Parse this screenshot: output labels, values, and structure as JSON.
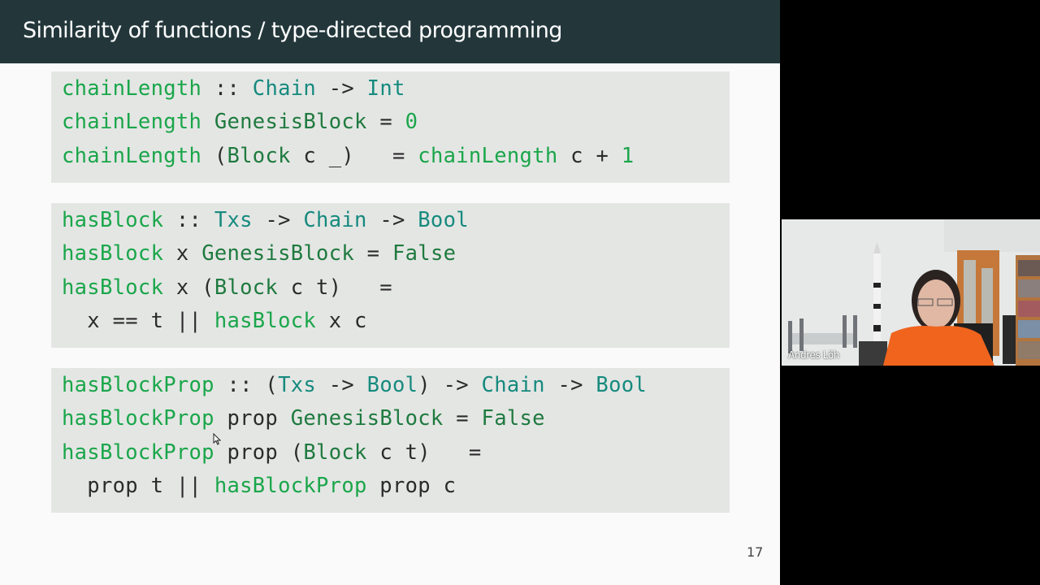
{
  "slide": {
    "title": "Similarity of functions / type-directed programming",
    "page_number": "17",
    "code_blocks": [
      {
        "lines": [
          [
            {
              "t": "chainLength",
              "k": "fn"
            },
            {
              "t": " :: ",
              "k": "op"
            },
            {
              "t": "Chain",
              "k": "ty"
            },
            {
              "t": " -> ",
              "k": "op"
            },
            {
              "t": "Int",
              "k": "ty"
            }
          ],
          [
            {
              "t": "chainLength",
              "k": "fn"
            },
            {
              "t": " ",
              "k": "op"
            },
            {
              "t": "GenesisBlock",
              "k": "con"
            },
            {
              "t": " = ",
              "k": "op"
            },
            {
              "t": "0",
              "k": "lit"
            }
          ],
          [
            {
              "t": "chainLength",
              "k": "fn"
            },
            {
              "t": " (",
              "k": "op"
            },
            {
              "t": "Block",
              "k": "con"
            },
            {
              "t": " c _)   = ",
              "k": "var"
            },
            {
              "t": "chainLength",
              "k": "fn"
            },
            {
              "t": " c + ",
              "k": "var"
            },
            {
              "t": "1",
              "k": "lit"
            }
          ]
        ]
      },
      {
        "lines": [
          [
            {
              "t": "hasBlock",
              "k": "fn"
            },
            {
              "t": " :: ",
              "k": "op"
            },
            {
              "t": "Txs",
              "k": "ty"
            },
            {
              "t": " -> ",
              "k": "op"
            },
            {
              "t": "Chain",
              "k": "ty"
            },
            {
              "t": " -> ",
              "k": "op"
            },
            {
              "t": "Bool",
              "k": "ty"
            }
          ],
          [
            {
              "t": "hasBlock",
              "k": "fn"
            },
            {
              "t": " x ",
              "k": "var"
            },
            {
              "t": "GenesisBlock",
              "k": "con"
            },
            {
              "t": " = ",
              "k": "op"
            },
            {
              "t": "False",
              "k": "con"
            }
          ],
          [
            {
              "t": "hasBlock",
              "k": "fn"
            },
            {
              "t": " x (",
              "k": "var"
            },
            {
              "t": "Block",
              "k": "con"
            },
            {
              "t": " c t)   =",
              "k": "var"
            }
          ],
          [
            {
              "t": "  x == t || ",
              "k": "var"
            },
            {
              "t": "hasBlock",
              "k": "fn"
            },
            {
              "t": " x c",
              "k": "var"
            }
          ]
        ]
      },
      {
        "lines": [
          [
            {
              "t": "hasBlockProp",
              "k": "fn"
            },
            {
              "t": " :: (",
              "k": "op"
            },
            {
              "t": "Txs",
              "k": "ty"
            },
            {
              "t": " -> ",
              "k": "op"
            },
            {
              "t": "Bool",
              "k": "ty"
            },
            {
              "t": ") -> ",
              "k": "op"
            },
            {
              "t": "Chain",
              "k": "ty"
            },
            {
              "t": " -> ",
              "k": "op"
            },
            {
              "t": "Bool",
              "k": "ty"
            }
          ],
          [
            {
              "t": "hasBlockProp",
              "k": "fn"
            },
            {
              "t": " prop ",
              "k": "var"
            },
            {
              "t": "GenesisBlock",
              "k": "con"
            },
            {
              "t": " = ",
              "k": "op"
            },
            {
              "t": "False",
              "k": "con"
            }
          ],
          [
            {
              "t": "hasBlockProp",
              "k": "fn"
            },
            {
              "t": " prop (",
              "k": "var"
            },
            {
              "t": "Block",
              "k": "con"
            },
            {
              "t": " c t)   =",
              "k": "var"
            }
          ],
          [
            {
              "t": "  prop t || ",
              "k": "var"
            },
            {
              "t": "hasBlockProp",
              "k": "fn"
            },
            {
              "t": " prop c",
              "k": "var"
            }
          ]
        ]
      }
    ]
  },
  "webcam": {
    "participant_name": "Andres Löh"
  },
  "colors": {
    "header_bg": "#23373b",
    "function_name": "#1aa64a",
    "type_name": "#168a7e",
    "constructor": "#1f7a3f",
    "code_bg": "#e4e6e4"
  }
}
